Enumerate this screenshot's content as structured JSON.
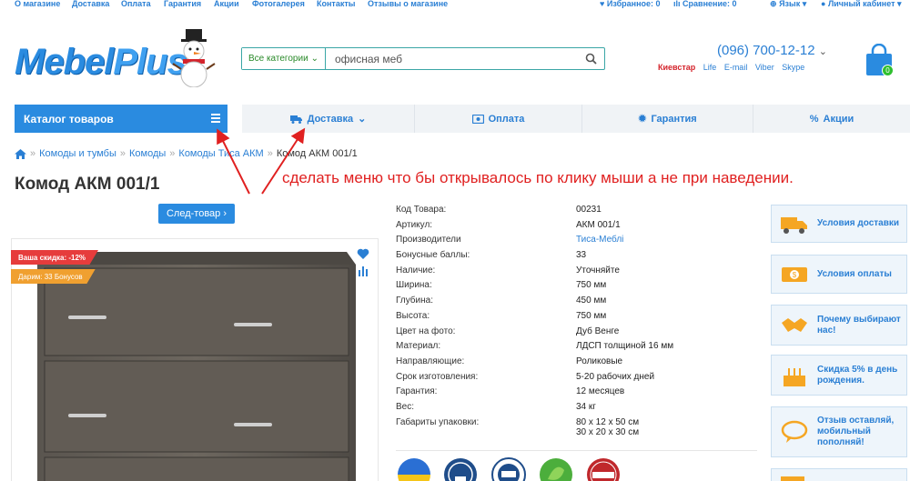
{
  "topbar": {
    "links": [
      "О магазине",
      "Доставка",
      "Оплата",
      "Гарантия",
      "Акции",
      "Фотогалерея",
      "Контакты",
      "Отзывы о магазине"
    ],
    "favorites": "Избранное: 0",
    "compare": "Сравнение: 0",
    "language": "Язык",
    "account": "Личный кабинет"
  },
  "logo": {
    "part1": "Mebel",
    "part2": "Plus"
  },
  "search": {
    "category": "Все категории",
    "value": "офисная меб"
  },
  "contacts": {
    "phone": "(096) 700-12-12",
    "operator": "Киевстар",
    "links": [
      "Life",
      "E-mail",
      "Viber",
      "Skype"
    ]
  },
  "cart": {
    "count": "0"
  },
  "catalog": {
    "label": "Каталог товаров"
  },
  "nav": [
    {
      "label": "Доставка",
      "icon": "truck-icon"
    },
    {
      "label": "Оплата",
      "icon": "wallet-icon"
    },
    {
      "label": "Гарантия",
      "icon": "gear-icon"
    },
    {
      "label": "Акции",
      "icon": "percent-icon"
    }
  ],
  "breadcrumb": [
    "Комоды и тумбы",
    "Комоды",
    "Комоды Тиса АКМ",
    "Комод АКМ 001/1"
  ],
  "product": {
    "title": "Комод АКМ 001/1",
    "next": "След-товар",
    "discount": "Ваша скидка: -12%",
    "bonus": "Дарим: 33 Бонусов"
  },
  "annotation": "сделать меню что бы открывалось по клику мыши а не при наведении.",
  "specs": [
    {
      "k": "Код Товара:",
      "v": "00231"
    },
    {
      "k": "Артикул:",
      "v": "АКМ 001/1"
    },
    {
      "k": "Производители",
      "v": "Тиса-Меблі"
    },
    {
      "k": "Бонусные баллы:",
      "v": "33"
    },
    {
      "k": "Наличие:",
      "v": "Уточняйте"
    },
    {
      "k": "Ширина:",
      "v": "750 мм"
    },
    {
      "k": "Глубина:",
      "v": "450 мм"
    },
    {
      "k": "Высота:",
      "v": "750 мм"
    },
    {
      "k": "Цвет на фото:",
      "v": "Дуб Венге"
    },
    {
      "k": "Материал:",
      "v": "ЛДСП толщиной 16 мм"
    },
    {
      "k": "Направляющие:",
      "v": "Роликовые"
    },
    {
      "k": "Срок изготовления:",
      "v": "5-20 рабочих дней"
    },
    {
      "k": "Гарантия:",
      "v": "12 месяцев"
    },
    {
      "k": "Вес:",
      "v": "34 кг"
    },
    {
      "k": "Габариты упаковки:",
      "v": "80 x 12 x 50 см",
      "v2": "30 x 20 x 30 см"
    }
  ],
  "side": [
    "Условия доставки",
    "Условия оплаты",
    "Почему выбирают нас!",
    "Скидка 5% в день рождения.",
    "Отзыв оставляй, мобильный пополняй!"
  ],
  "colors": {
    "accent": "#2a8be0",
    "annotation": "#e02020",
    "discount": "#e63c3c",
    "bonus": "#f0a030"
  }
}
